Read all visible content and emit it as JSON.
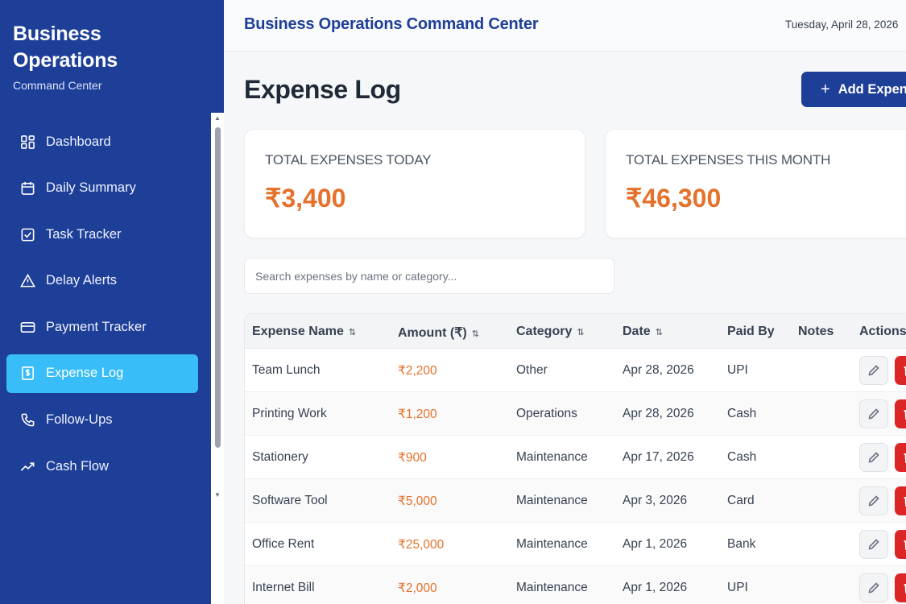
{
  "sidebar": {
    "brand_title": "Business Operations",
    "brand_subtitle": "Command Center",
    "items": [
      {
        "label": "Dashboard",
        "icon": "grid-icon"
      },
      {
        "label": "Daily Summary",
        "icon": "calendar-icon"
      },
      {
        "label": "Task Tracker",
        "icon": "checkbox-icon"
      },
      {
        "label": "Delay Alerts",
        "icon": "warning-icon"
      },
      {
        "label": "Payment Tracker",
        "icon": "card-icon"
      },
      {
        "label": "Expense Log",
        "icon": "receipt-icon",
        "active": true
      },
      {
        "label": "Follow-Ups",
        "icon": "phone-icon"
      },
      {
        "label": "Cash Flow",
        "icon": "trend-icon"
      }
    ]
  },
  "header": {
    "title": "Business Operations Command Center",
    "date": "Tuesday, April 28, 2026"
  },
  "page": {
    "title": "Expense Log",
    "add_button_label": "Add Expense"
  },
  "stats": {
    "today_label": "TOTAL EXPENSES TODAY",
    "today_value": "₹3,400",
    "month_label": "TOTAL EXPENSES THIS MONTH",
    "month_value": "₹46,300"
  },
  "search": {
    "placeholder": "Search expenses by name or category..."
  },
  "table": {
    "columns": [
      "Expense Name",
      "Amount (₹)",
      "Category",
      "Date",
      "Paid By",
      "Notes",
      "Actions"
    ],
    "sort_icon": "⇅",
    "rows": [
      {
        "name": "Team Lunch",
        "amount": "₹2,200",
        "category": "Other",
        "date": "Apr 28, 2026",
        "paid_by": "UPI",
        "notes": ""
      },
      {
        "name": "Printing Work",
        "amount": "₹1,200",
        "category": "Operations",
        "date": "Apr 28, 2026",
        "paid_by": "Cash",
        "notes": ""
      },
      {
        "name": "Stationery",
        "amount": "₹900",
        "category": "Maintenance",
        "date": "Apr 17, 2026",
        "paid_by": "Cash",
        "notes": ""
      },
      {
        "name": "Software Tool",
        "amount": "₹5,000",
        "category": "Maintenance",
        "date": "Apr 3, 2026",
        "paid_by": "Card",
        "notes": ""
      },
      {
        "name": "Office Rent",
        "amount": "₹25,000",
        "category": "Maintenance",
        "date": "Apr 1, 2026",
        "paid_by": "Bank",
        "notes": ""
      },
      {
        "name": "Internet Bill",
        "amount": "₹2,000",
        "category": "Maintenance",
        "date": "Apr 1, 2026",
        "paid_by": "UPI",
        "notes": ""
      }
    ]
  },
  "colors": {
    "sidebar_bg": "#1e3f98",
    "active_item": "#38bdf8",
    "amount": "#e5712a",
    "delete": "#dc2626"
  }
}
